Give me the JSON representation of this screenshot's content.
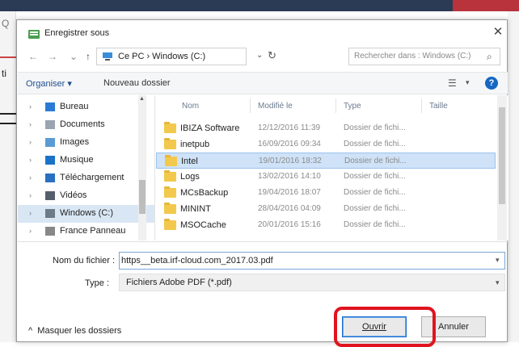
{
  "background": {
    "left_fragment_top": "Q",
    "left_fragment_mid": "ti"
  },
  "dialog": {
    "title": "Enregistrer sous",
    "close_glyph": "✕"
  },
  "nav": {
    "back": "←",
    "forward": "→",
    "history": "⌄",
    "up": "↑"
  },
  "address": {
    "path": "Ce PC  ›  Windows (C:)",
    "chevron": "⌄",
    "refresh": "↻"
  },
  "search": {
    "placeholder": "Rechercher dans : Windows (C:)",
    "icon": "⌕"
  },
  "toolbar": {
    "organiser": "Organiser ▾",
    "new_folder": "Nouveau dossier",
    "view_icon": "☰",
    "view_chevron": "▾",
    "help": "?"
  },
  "tree": [
    {
      "label": "Bureau",
      "icon": "desktop-icon",
      "color": "#2b7bd6"
    },
    {
      "label": "Documents",
      "icon": "documents-icon",
      "color": "#9aa5b1"
    },
    {
      "label": "Images",
      "icon": "images-icon",
      "color": "#5b9bd5"
    },
    {
      "label": "Musique",
      "icon": "music-icon",
      "color": "#1a73c8"
    },
    {
      "label": "Téléchargement",
      "icon": "download-icon",
      "color": "#2a6fc2"
    },
    {
      "label": "Vidéos",
      "icon": "videos-icon",
      "color": "#555f6b"
    },
    {
      "label": "Windows (C:)",
      "icon": "drive-icon",
      "color": "#6d7a87"
    },
    {
      "label": "France Panneau",
      "icon": "drive-icon",
      "color": "#888888"
    }
  ],
  "columns": {
    "name": "Nom",
    "modified": "Modifié le",
    "type": "Type",
    "size": "Taille"
  },
  "files": [
    {
      "name": "IBIZA Software",
      "date": "12/12/2016 11:39",
      "type": "Dossier de fichi..."
    },
    {
      "name": "inetpub",
      "date": "16/09/2016 09:34",
      "type": "Dossier de fichi..."
    },
    {
      "name": "Intel",
      "date": "19/01/2016 18:32",
      "type": "Dossier de fichi..."
    },
    {
      "name": "Logs",
      "date": "13/02/2016 14:10",
      "type": "Dossier de fichi..."
    },
    {
      "name": "MCsBackup",
      "date": "19/04/2016 18:07",
      "type": "Dossier de fichi..."
    },
    {
      "name": "MININT",
      "date": "28/04/2016 04:09",
      "type": "Dossier de fichi..."
    },
    {
      "name": "MSOCache",
      "date": "20/01/2016 15:16",
      "type": "Dossier de fichi..."
    }
  ],
  "form": {
    "filename_label": "Nom du fichier :",
    "filename_value": "https__beta.irf-cloud.com_2017.03.pdf",
    "type_label": "Type :",
    "type_value": "Fichiers Adobe PDF (*.pdf)"
  },
  "footer": {
    "hide_folders": "Masquer les dossiers",
    "open": "Ouvrir",
    "cancel": "Annuler"
  }
}
